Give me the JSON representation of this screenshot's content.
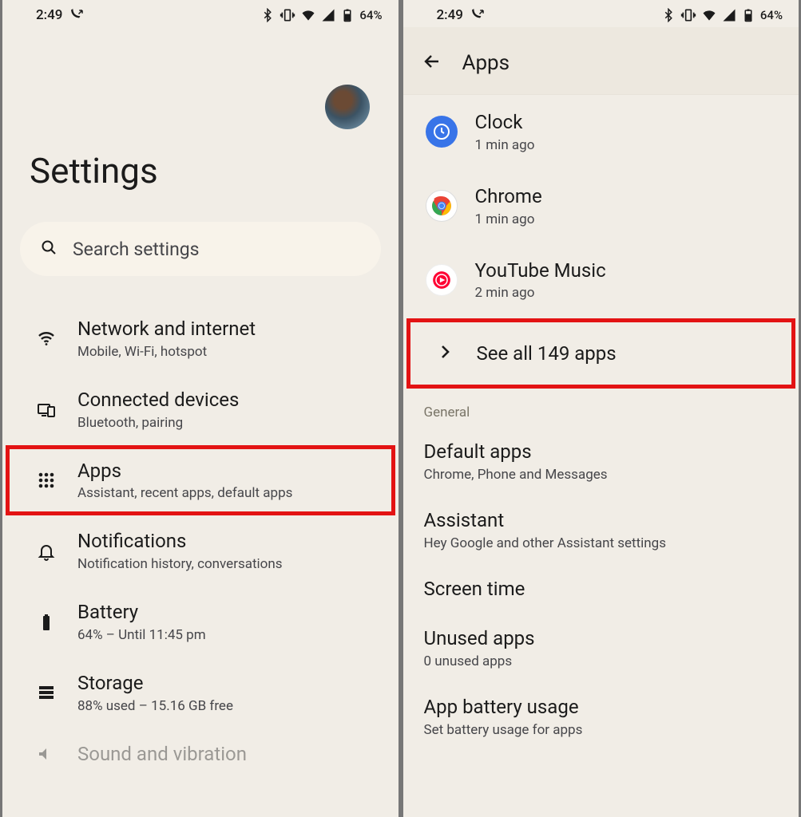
{
  "status": {
    "time": "2:49",
    "battery_pct": "64%"
  },
  "left": {
    "title": "Settings",
    "search_placeholder": "Search settings",
    "items": [
      {
        "title": "Network and internet",
        "subtitle": "Mobile, Wi-Fi, hotspot"
      },
      {
        "title": "Connected devices",
        "subtitle": "Bluetooth, pairing"
      },
      {
        "title": "Apps",
        "subtitle": "Assistant, recent apps, default apps"
      },
      {
        "title": "Notifications",
        "subtitle": "Notification history, conversations"
      },
      {
        "title": "Battery",
        "subtitle": "64% – Until 11:45 pm"
      },
      {
        "title": "Storage",
        "subtitle": "88% used – 15.16 GB free"
      },
      {
        "title": "Sound and vibration",
        "subtitle": ""
      }
    ]
  },
  "right": {
    "header": "Apps",
    "recent": [
      {
        "name": "Clock",
        "sub": "1 min ago"
      },
      {
        "name": "Chrome",
        "sub": "1 min ago"
      },
      {
        "name": "YouTube Music",
        "sub": "2 min ago"
      }
    ],
    "see_all": "See all 149 apps",
    "section": "General",
    "prefs": [
      {
        "title": "Default apps",
        "subtitle": "Chrome, Phone and Messages"
      },
      {
        "title": "Assistant",
        "subtitle": "Hey Google and other Assistant settings"
      },
      {
        "title": "Screen time",
        "subtitle": ""
      },
      {
        "title": "Unused apps",
        "subtitle": "0 unused apps"
      },
      {
        "title": "App battery usage",
        "subtitle": "Set battery usage for apps"
      }
    ]
  }
}
